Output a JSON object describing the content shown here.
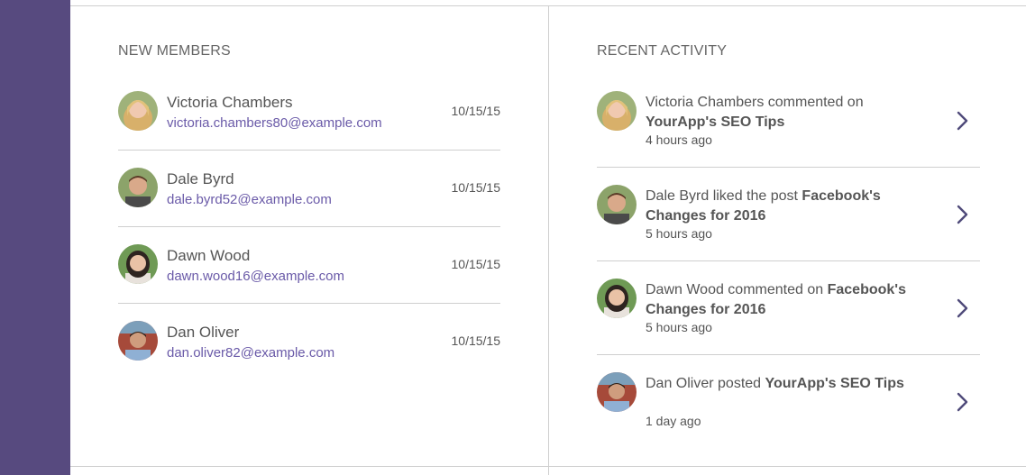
{
  "new_members": {
    "title": "NEW MEMBERS",
    "members": [
      {
        "name": "Victoria Chambers",
        "email": "victoria.chambers80@example.com",
        "date": "10/15/15"
      },
      {
        "name": "Dale Byrd",
        "email": "dale.byrd52@example.com",
        "date": "10/15/15"
      },
      {
        "name": "Dawn Wood",
        "email": "dawn.wood16@example.com",
        "date": "10/15/15"
      },
      {
        "name": "Dan Oliver",
        "email": "dan.oliver82@example.com",
        "date": "10/15/15"
      }
    ]
  },
  "recent_activity": {
    "title": "RECENT ACTIVITY",
    "items": [
      {
        "prefix": "Victoria Chambers commented on ",
        "target": "YourApp's SEO Tips",
        "time": "4 hours ago"
      },
      {
        "prefix": "Dale Byrd liked the post ",
        "target": "Facebook's Changes for 2016",
        "time": "5 hours ago"
      },
      {
        "prefix": "Dawn Wood commented on ",
        "target": "Facebook's Changes for 2016",
        "time": "5 hours ago"
      },
      {
        "prefix": "Dan Oliver posted ",
        "target": "YourApp's SEO Tips",
        "time": "1 day ago"
      }
    ]
  },
  "colors": {
    "sidebar": "#574a7f",
    "email_link": "#6a5aa8",
    "chevron": "#4f4a7a",
    "divider": "#cfcfcf"
  },
  "icons": {
    "chevron": "chevron-right-icon"
  }
}
